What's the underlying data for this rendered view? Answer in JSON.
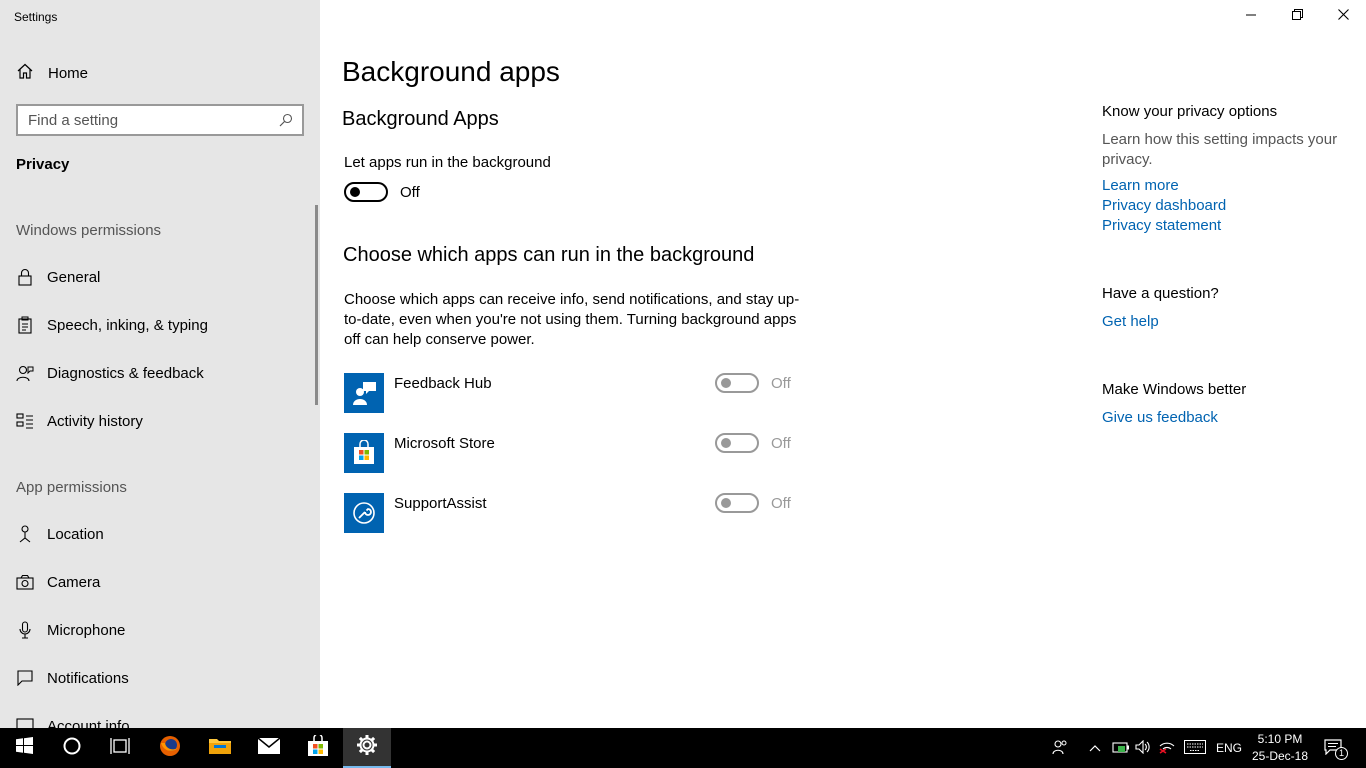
{
  "window": {
    "title": "Settings",
    "minimize_icon": "minimize-icon",
    "restore_icon": "restore-icon",
    "close_icon": "close-icon"
  },
  "sidebar": {
    "home_label": "Home",
    "search_placeholder": "Find a setting",
    "current_section": "Privacy",
    "groups": [
      {
        "header": "Windows permissions",
        "items": [
          {
            "label": "General",
            "icon": "lock-icon"
          },
          {
            "label": "Speech, inking, & typing",
            "icon": "clipboard-icon"
          },
          {
            "label": "Diagnostics & feedback",
            "icon": "person-feedback-icon"
          },
          {
            "label": "Activity history",
            "icon": "timeline-icon"
          }
        ]
      },
      {
        "header": "App permissions",
        "items": [
          {
            "label": "Location",
            "icon": "location-icon"
          },
          {
            "label": "Camera",
            "icon": "camera-icon"
          },
          {
            "label": "Microphone",
            "icon": "microphone-icon"
          },
          {
            "label": "Notifications",
            "icon": "notification-icon"
          },
          {
            "label": "Account info",
            "icon": "account-info-icon"
          }
        ]
      }
    ]
  },
  "main": {
    "page_title": "Background apps",
    "section_title": "Background Apps",
    "master_toggle": {
      "label": "Let apps run in the background",
      "state": "Off",
      "on": false
    },
    "apps_section_title": "Choose which apps can run in the background",
    "apps_description": "Choose which apps can receive info, send notifications, and stay up-to-date, even when you're not using them. Turning background apps off can help conserve power.",
    "apps": [
      {
        "name": "Feedback Hub",
        "state": "Off",
        "icon": "feedback-hub-icon"
      },
      {
        "name": "Microsoft Store",
        "state": "Off",
        "icon": "microsoft-store-icon"
      },
      {
        "name": "SupportAssist",
        "state": "Off",
        "icon": "supportassist-icon"
      }
    ]
  },
  "right_panel": {
    "privacy_heading": "Know your privacy options",
    "privacy_text": "Learn how this setting impacts your privacy.",
    "links": [
      "Learn more",
      "Privacy dashboard",
      "Privacy statement"
    ],
    "question_heading": "Have a question?",
    "help_link": "Get help",
    "better_heading": "Make Windows better",
    "feedback_link": "Give us feedback"
  },
  "taskbar": {
    "language": "ENG",
    "time": "5:10 PM",
    "date": "25-Dec-18",
    "notification_count": "1",
    "accent_color": "#76b9ed"
  },
  "colors": {
    "link": "#0063b1",
    "sidebar_bg": "#e6e6e6",
    "app_tile": "#0063b1"
  }
}
